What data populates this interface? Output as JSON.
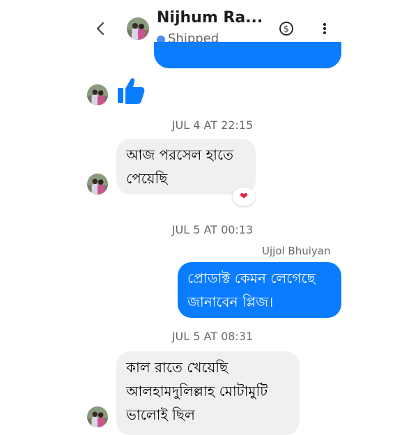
{
  "header": {
    "back_icon": "chevron-left-icon",
    "contact_name": "Nijhum Ra...",
    "status": "Shipped",
    "status_color": "#4c8bf5",
    "payment_icon": "dollar-circle-icon",
    "more_icon": "vertical-dots-icon"
  },
  "conversation": {
    "like_icon": "thumbs-up-icon",
    "timestamps": [
      "JUL 4 AT 22:15",
      "JUL 5 AT 00:13",
      "JUL 5 AT 08:31"
    ],
    "messages": [
      {
        "direction": "incoming",
        "text": "আজ পরসেল হাতে পেয়েছি",
        "reaction": "❤"
      },
      {
        "direction": "outgoing",
        "sender": "Ujjol Bhuiyan",
        "text": "প্রোডাক্ট কেমন লেগেছে জানাবেন প্লিজ।"
      },
      {
        "direction": "incoming",
        "text": "কাল রাতে খেয়েছি আলহামদুলিল্লাহ মোটামুটি ভালোই ছিল"
      }
    ]
  },
  "colors": {
    "outgoing_bubble": "#0a7cff",
    "incoming_bubble": "#f0f0f2",
    "like": "#0a7cff"
  }
}
